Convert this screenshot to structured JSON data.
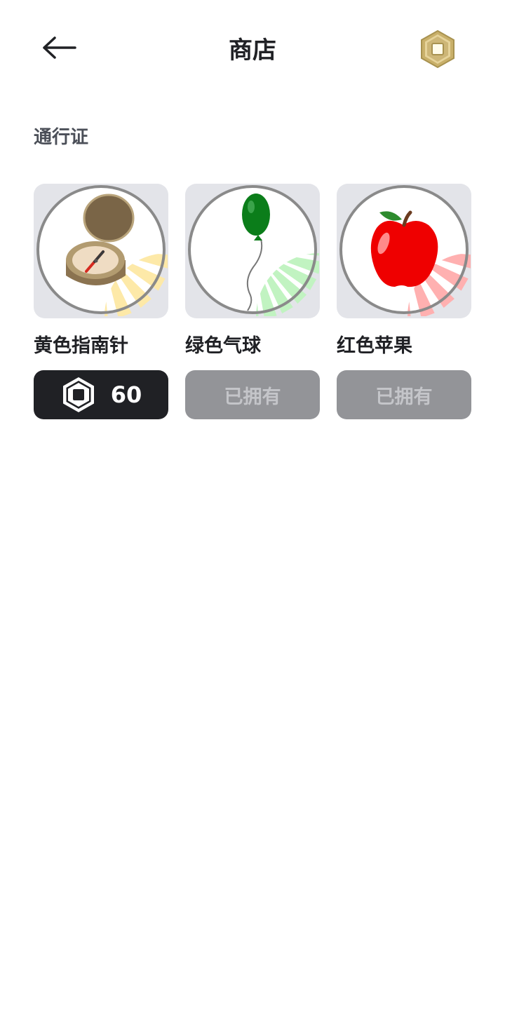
{
  "header": {
    "title": "商店",
    "back_icon": "arrow-left-icon",
    "currency_icon": "robux-icon"
  },
  "section": {
    "title": "通行证"
  },
  "items": [
    {
      "name": "黄色指南针",
      "image_icon": "compass-icon",
      "action": "buy",
      "price": "60",
      "price_icon": "robux-icon"
    },
    {
      "name": "绿色气球",
      "image_icon": "balloon-icon",
      "action": "owned",
      "status_label": "已拥有"
    },
    {
      "name": "红色苹果",
      "image_icon": "apple-icon",
      "action": "owned",
      "status_label": "已拥有"
    }
  ],
  "colors": {
    "primary_dark": "#202125",
    "owned_button": "#939498",
    "owned_text": "#c4c5c9",
    "thumb_bg": "#e3e4e9",
    "gold": "#c9b06a",
    "yellow_ray": "#fde9a8",
    "green_ray": "#c1f3c1",
    "red_ray": "#ffb0b0"
  }
}
